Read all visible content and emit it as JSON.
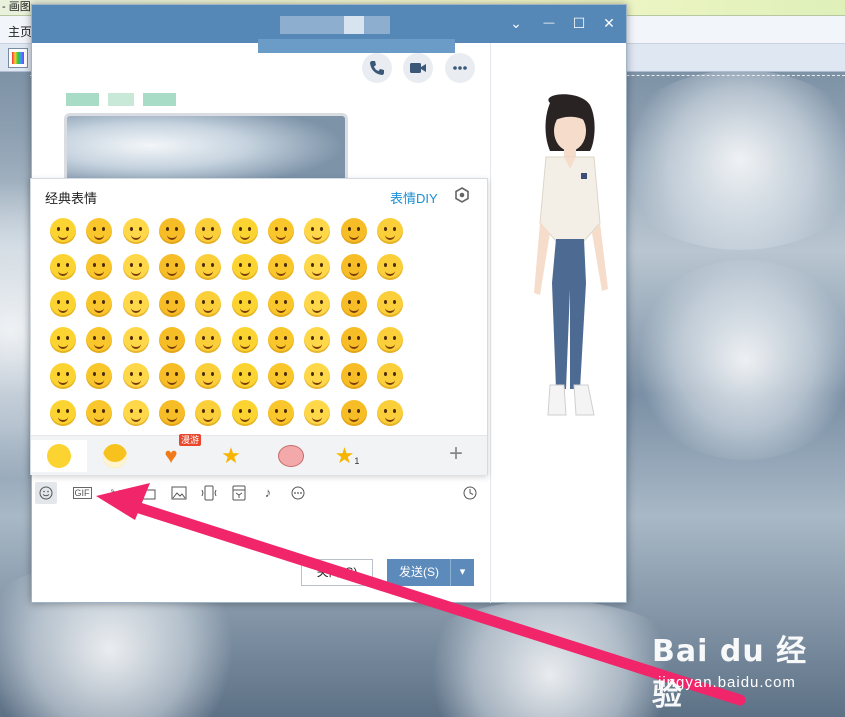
{
  "paint": {
    "title_fragment": "- 画图",
    "ribbon_tab": "主页"
  },
  "chat": {
    "window_controls": {
      "collapse": "⌄",
      "minimize": "—",
      "maximize": "☐",
      "close": "✕"
    },
    "emoji_panel": {
      "title": "经典表情",
      "diy_link": "表情DIY",
      "rows": 6,
      "columns": 10,
      "tabs": [
        {
          "name": "classic",
          "active": true
        },
        {
          "name": "smiley",
          "active": false
        },
        {
          "name": "heart",
          "badge": "漫游",
          "active": false
        },
        {
          "name": "favorites-star",
          "active": false
        },
        {
          "name": "cartoon-pig",
          "active": false
        },
        {
          "name": "star-1",
          "badge": "1",
          "active": false
        }
      ],
      "add_label": "+"
    },
    "toolbar": {
      "gif_label": "GIF"
    },
    "buttons": {
      "close": "关闭(C)",
      "send": "发送(S)",
      "send_dropdown": "▾"
    },
    "colors": {
      "titlebar": "#5587b7",
      "send_button": "#5c8bbb",
      "accent_link": "#1b8fd6",
      "annotation_arrow": "#f0256a"
    }
  },
  "watermark": {
    "logo": "Bai du 经验",
    "url": "jingyan.baidu.com"
  }
}
